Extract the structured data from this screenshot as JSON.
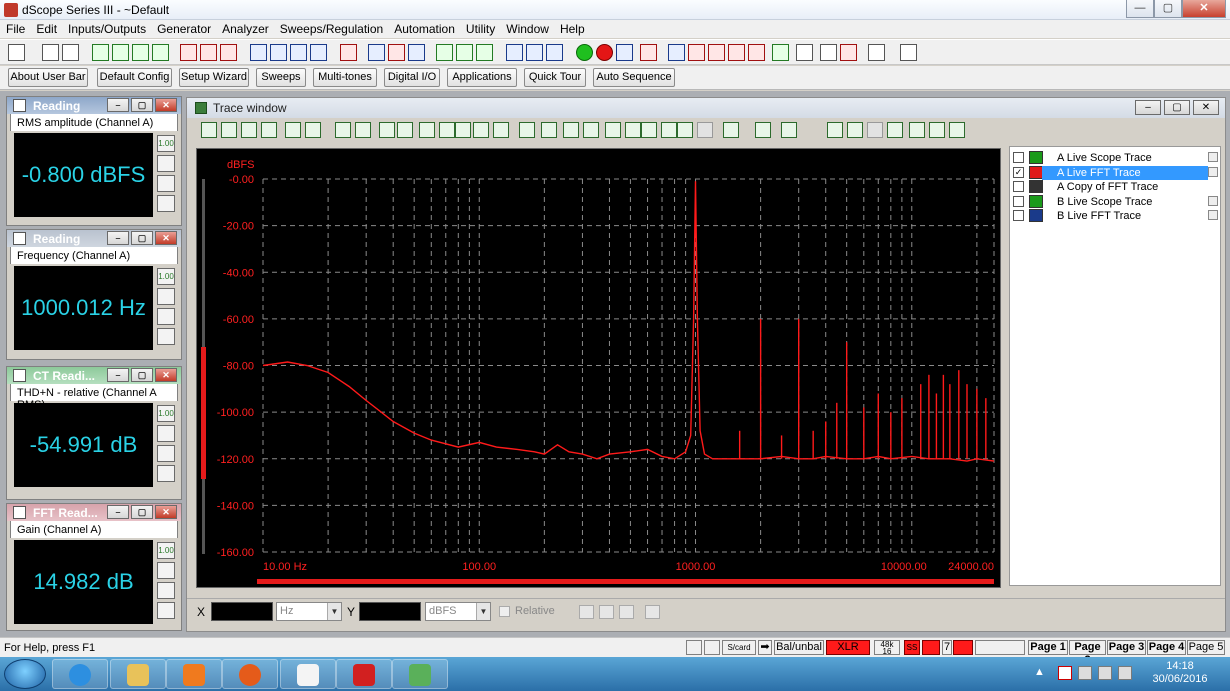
{
  "window": {
    "title": "dScope Series III - ~Default"
  },
  "menu": [
    "File",
    "Edit",
    "Inputs/Outputs",
    "Generator",
    "Analyzer",
    "Sweeps/Regulation",
    "Automation",
    "Utility",
    "Window",
    "Help"
  ],
  "buttons": [
    "About User Bar",
    "Default Config",
    "Setup Wizard",
    "Sweeps",
    "Multi-tones",
    "Digital I/O",
    "Applications",
    "Quick Tour",
    "Auto Sequence"
  ],
  "readings": [
    {
      "title": "Reading",
      "label": "RMS amplitude (Channel A)",
      "value": "-0.800 dBFS"
    },
    {
      "title": "Reading",
      "label": "Frequency (Channel A)",
      "value": "1000.012 Hz"
    },
    {
      "title": "CT Readi...",
      "label": "THD+N - relative (Channel A RMS)",
      "value": "-54.991 dB"
    },
    {
      "title": "FFT Read...",
      "label": "Gain (Channel A)",
      "value": "14.982 dB"
    }
  ],
  "reading_side": {
    "badge": "1.00"
  },
  "trace_window": {
    "title": "Trace window"
  },
  "traces": [
    {
      "channel": "A",
      "name": "Live Scope Trace",
      "checked": false,
      "selected": false,
      "color": "#1a9a1a"
    },
    {
      "channel": "A",
      "name": "Live FFT Trace",
      "checked": true,
      "selected": true,
      "color": "#e01a1a"
    },
    {
      "channel": "A",
      "name": "Copy of FFT Trace",
      "checked": false,
      "selected": false,
      "color": "#333333"
    },
    {
      "channel": "B",
      "name": "Live Scope Trace",
      "checked": false,
      "selected": false,
      "color": "#1a9a1a"
    },
    {
      "channel": "B",
      "name": "Live FFT Trace",
      "checked": false,
      "selected": false,
      "color": "#1a3a8a"
    }
  ],
  "check_mark": "✓",
  "cursor": {
    "x_label": "X",
    "x_unit": "Hz",
    "y_label": "Y",
    "y_unit": "dBFS",
    "relative_label": "Relative"
  },
  "chart_data": {
    "type": "line",
    "ylabel": "dBFS",
    "xscale": "log",
    "xlim": [
      10,
      24000
    ],
    "ylim": [
      -160,
      0
    ],
    "yticks": [
      "-0.00",
      "-20.00",
      "-40.00",
      "-60.00",
      "-80.00",
      "-100.00",
      "-120.00",
      "-140.00",
      "-160.00"
    ],
    "xticks": [
      {
        "value": 10,
        "label": "10.00 Hz"
      },
      {
        "value": 100,
        "label": "100.00"
      },
      {
        "value": 1000,
        "label": "1000.00"
      },
      {
        "value": 10000,
        "label": "10000.00"
      },
      {
        "value": 24000,
        "label": "24000.00"
      }
    ],
    "grid": true,
    "series": [
      {
        "color": "#ff1a1a",
        "x": [
          10,
          13,
          16,
          20,
          25,
          30,
          40,
          50,
          60,
          80,
          100,
          120,
          150,
          180,
          200,
          230,
          260,
          300,
          350,
          400,
          500,
          600,
          700,
          800,
          900,
          950,
          980,
          1000,
          1020,
          1050,
          1100,
          1200,
          1500,
          2000,
          2500,
          3000,
          3500,
          4000,
          5000,
          6000,
          7000,
          8000,
          10000,
          12000,
          15000,
          18000,
          20000,
          24000
        ],
        "y": [
          -80,
          -78.5,
          -80,
          -83,
          -89,
          -95,
          -104,
          -109,
          -112,
          -115,
          -113,
          -115,
          -116,
          -117,
          -118,
          -114,
          -117,
          -118,
          -120,
          -118,
          -117,
          -116,
          -119,
          -120,
          -117,
          -110,
          -60,
          -1,
          -60,
          -108,
          -118,
          -120,
          -120,
          -120,
          -119,
          -120,
          -120,
          -119,
          -120,
          -120,
          -119,
          -120,
          -119,
          -120,
          -120,
          -121,
          -120,
          -121
        ]
      }
    ],
    "spikes": [
      {
        "x": 2000,
        "y": -60
      },
      {
        "x": 3000,
        "y": -60
      },
      {
        "x": 5000,
        "y": -70
      },
      {
        "x": 1600,
        "y": -108
      },
      {
        "x": 2500,
        "y": -110
      },
      {
        "x": 3500,
        "y": -108
      },
      {
        "x": 4000,
        "y": -104
      },
      {
        "x": 4500,
        "y": -96
      },
      {
        "x": 6000,
        "y": -98
      },
      {
        "x": 7000,
        "y": -92
      },
      {
        "x": 8000,
        "y": -100
      },
      {
        "x": 9000,
        "y": -94
      },
      {
        "x": 11000,
        "y": -88
      },
      {
        "x": 12000,
        "y": -84
      },
      {
        "x": 13000,
        "y": -92
      },
      {
        "x": 14000,
        "y": -84
      },
      {
        "x": 15000,
        "y": -88
      },
      {
        "x": 16500,
        "y": -82
      },
      {
        "x": 18000,
        "y": -88
      },
      {
        "x": 20000,
        "y": -90
      },
      {
        "x": 22000,
        "y": -94
      }
    ]
  },
  "status": {
    "help": "For Help, press F1",
    "scard": "S/card",
    "balunbal": "Bal/unbal",
    "xlr": "XLR",
    "rate": "48k 16",
    "ss": "SS",
    "num": "7",
    "pages": [
      "Page 1",
      "Page 2",
      "Page 3",
      "Page 4",
      "Page 5"
    ]
  },
  "clock": {
    "time": "14:18",
    "date": "30/06/2016"
  },
  "tray": {
    "arrow": "▲"
  },
  "colors": {
    "trace": "#ff1a1a",
    "reading_text": "#2ad2e6",
    "grid": "#8a8a8a"
  }
}
